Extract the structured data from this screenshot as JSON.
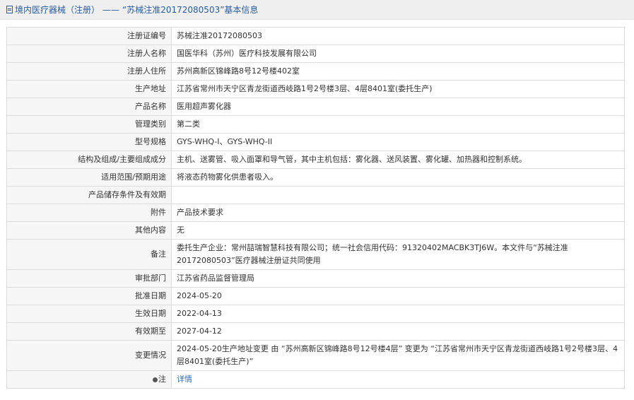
{
  "header": {
    "section": "境内医疗器械（注册）",
    "separator": "——",
    "title": "“苏械注准20172080503”基本信息"
  },
  "fields": [
    {
      "label": "注册证编号",
      "value": "苏械注准20172080503"
    },
    {
      "label": "注册人名称",
      "value": "国医华科（苏州）医疗科技发展有限公司"
    },
    {
      "label": "注册人住所",
      "value": "苏州高新区锦峰路8号12号楼402室"
    },
    {
      "label": "生产地址",
      "value": "江苏省常州市天宁区青龙街道西岐路1号2号楼3层、4层8401室(委托生产)"
    },
    {
      "label": "产品名称",
      "value": "医用超声雾化器"
    },
    {
      "label": "管理类别",
      "value": "第二类"
    },
    {
      "label": "型号规格",
      "value": "GYS-WHQ-I、GYS-WHQ-II"
    },
    {
      "label": "结构及组成/主要组成成分",
      "value": "主机、送雾管、吸入面罩和导气管，其中主机包括：雾化器、送风装置、雾化罐、加热器和控制系统。"
    },
    {
      "label": "适用范围/预期用途",
      "value": "将液态药物雾化供患者吸入。"
    },
    {
      "label": "产品储存条件及有效期",
      "value": ""
    },
    {
      "label": "附件",
      "value": "产品技术要求"
    },
    {
      "label": "其他内容",
      "value": "无"
    },
    {
      "label": "备注",
      "value": "委托生产企业：常州喆瑞智慧科技有限公司；统一社会信用代码：91320402MACBK3TJ6W。本文件与“苏械注准20172080503”医疗器械注册证共同使用"
    },
    {
      "label": "审批部门",
      "value": "江苏省药品监督管理局"
    },
    {
      "label": "批准日期",
      "value": "2024-05-20"
    },
    {
      "label": "生效日期",
      "value": "2022-04-13"
    },
    {
      "label": "有效期至",
      "value": "2027-04-12"
    },
    {
      "label": "变更情况",
      "value": "2024-05-20生产地址变更 由 “苏州高新区锦峰路8号12号楼4层” 变更为 “江苏省常州市天宁区青龙街道西岐路1号2号楼3层、4层8401室(委托生产)”"
    }
  ],
  "note": {
    "label": "注",
    "link_text": "详情"
  }
}
